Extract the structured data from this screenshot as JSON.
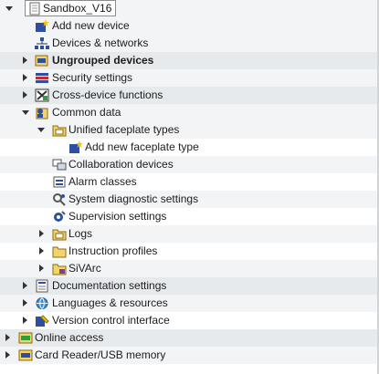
{
  "tree": {
    "root": {
      "label": "Sandbox_V16",
      "icon": "project-icon"
    },
    "items": [
      {
        "label": "Add new device",
        "icon": "add-device-icon"
      },
      {
        "label": "Devices & networks",
        "icon": "network-icon"
      },
      {
        "label": "Ungrouped devices",
        "icon": "ungrouped-devices-icon"
      },
      {
        "label": "Security settings",
        "icon": "security-settings-icon"
      },
      {
        "label": "Cross-device functions",
        "icon": "cross-device-icon"
      },
      {
        "label": "Common data",
        "icon": "common-data-icon"
      },
      {
        "label": "Unified faceplate types",
        "icon": "folder-icon"
      },
      {
        "label": "Add new faceplate type",
        "icon": "add-faceplate-icon"
      },
      {
        "label": "Collaboration devices",
        "icon": "collaboration-icon"
      },
      {
        "label": "Alarm classes",
        "icon": "alarm-classes-icon"
      },
      {
        "label": "System diagnostic settings",
        "icon": "diagnostic-icon"
      },
      {
        "label": "Supervision settings",
        "icon": "supervision-icon"
      },
      {
        "label": "Logs",
        "icon": "folder-icon"
      },
      {
        "label": "Instruction profiles",
        "icon": "folder-icon"
      },
      {
        "label": "SiVArc",
        "icon": "folder-icon"
      },
      {
        "label": "Documentation settings",
        "icon": "documentation-icon"
      },
      {
        "label": "Languages & resources",
        "icon": "languages-icon"
      },
      {
        "label": "Version control interface",
        "icon": "version-control-icon"
      },
      {
        "label": "Online access",
        "icon": "online-access-icon"
      },
      {
        "label": "Card Reader/USB memory",
        "icon": "card-reader-icon"
      }
    ]
  }
}
